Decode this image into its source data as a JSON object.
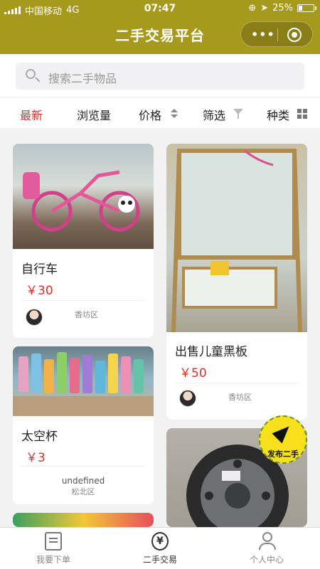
{
  "status_bar": {
    "carrier": "中国移动",
    "network": "4G",
    "time": "07:47",
    "battery": "25%",
    "battery_level": 0.25
  },
  "header": {
    "title": "二手交易平台",
    "more_icon": "more-dots-icon",
    "close_icon": "target-circle-icon"
  },
  "search": {
    "placeholder": "搜索二手物品"
  },
  "filters": [
    {
      "label": "最新",
      "active": true
    },
    {
      "label": "浏览量"
    },
    {
      "label": "价格",
      "icon": "sort-arrows-icon"
    },
    {
      "label": "筛选",
      "icon": "funnel-icon"
    },
    {
      "label": "种类",
      "icon": "grid-icon"
    }
  ],
  "items": [
    {
      "name": "自行车",
      "price": "￥30",
      "location": "香坊区"
    },
    {
      "name": "出售儿童黑板",
      "price": "￥50",
      "location": "香坊区"
    },
    {
      "name": "太空杯",
      "price": "￥3",
      "user": "undefined",
      "location": "松北区"
    }
  ],
  "publish_button": {
    "label": "发布二手",
    "icon": "paper-plane-icon"
  },
  "tabbar": [
    {
      "label": "我要下单",
      "icon": "order-doc-icon"
    },
    {
      "label": "二手交易",
      "icon": "yen-exchange-icon",
      "active": true
    },
    {
      "label": "个人中心",
      "icon": "user-icon"
    }
  ],
  "colors": {
    "header": "#a6991c",
    "accent_red": "#d9322e",
    "publish_yellow": "#f7e11b"
  }
}
